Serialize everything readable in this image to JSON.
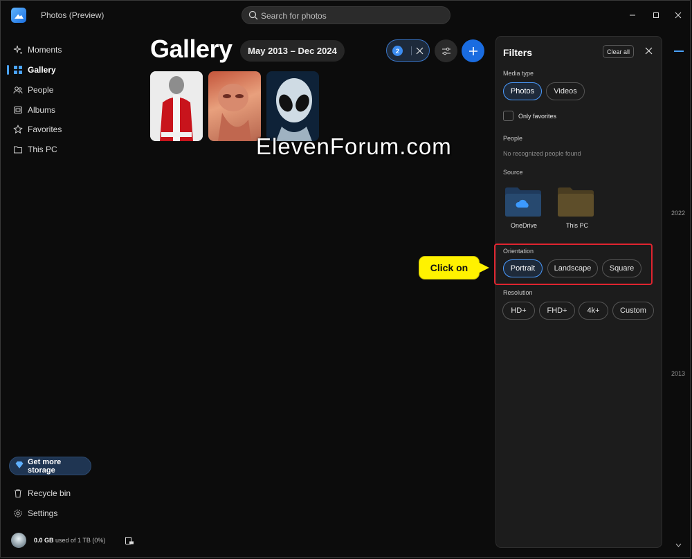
{
  "app": {
    "title": "Photos (Preview)"
  },
  "search": {
    "placeholder": "Search for photos"
  },
  "sidebar": {
    "items": [
      {
        "label": "Moments"
      },
      {
        "label": "Gallery"
      },
      {
        "label": "People"
      },
      {
        "label": "Albums"
      },
      {
        "label": "Favorites"
      },
      {
        "label": "This PC"
      }
    ],
    "active": "Gallery",
    "storage_button": "Get more storage",
    "recycle_bin": "Recycle bin",
    "settings": "Settings",
    "usage": {
      "used": "0.0 GB",
      "rest": " used of 1 TB (0%)"
    }
  },
  "header": {
    "title": "Gallery",
    "date_range": "May 2013 – Dec 2024",
    "filter_count": "2"
  },
  "watermark": "ElevenForum.com",
  "filters": {
    "title": "Filters",
    "clear_all": "Clear all",
    "media_type": {
      "label": "Media type",
      "options": [
        "Photos",
        "Videos"
      ],
      "selected": "Photos"
    },
    "only_favorites": {
      "label": "Only favorites",
      "checked": false
    },
    "people": {
      "label": "People",
      "empty": "No recognized people found"
    },
    "source": {
      "label": "Source",
      "options": [
        "OneDrive",
        "This PC"
      ]
    },
    "orientation": {
      "label": "Orientation",
      "options": [
        "Portrait",
        "Landscape",
        "Square"
      ],
      "selected": "Portrait"
    },
    "resolution": {
      "label": "Resolution",
      "options": [
        "HD+",
        "FHD+",
        "4k+",
        "Custom"
      ]
    }
  },
  "callout": {
    "text": "Click on"
  },
  "timeline": {
    "years": [
      "2022",
      "2013"
    ]
  },
  "colors": {
    "accent": "#1a6ce0",
    "highlight": "#e0242f",
    "callout": "#fff200"
  }
}
